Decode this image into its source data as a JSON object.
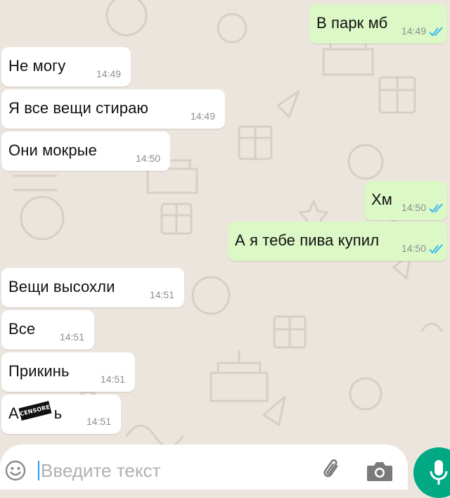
{
  "messages": [
    {
      "dir": "out",
      "text": "В парк мб",
      "time": "14:49",
      "read": true
    },
    {
      "dir": "in",
      "text": "Не могу",
      "time": "14:49"
    },
    {
      "dir": "in",
      "text": "Я все вещи стираю",
      "time": "14:49"
    },
    {
      "dir": "in",
      "text": "Они мокрые",
      "time": "14:50"
    },
    {
      "dir": "out",
      "text": "Хм",
      "time": "14:50",
      "read": true
    },
    {
      "dir": "out",
      "text": "А я тебе пива купил",
      "time": "14:50",
      "read": true
    },
    {
      "dir": "in",
      "text": "Вещи высохли",
      "time": "14:51"
    },
    {
      "dir": "in",
      "text": "Все",
      "time": "14:51"
    },
    {
      "dir": "in",
      "text": "Прикинь",
      "time": "14:51"
    },
    {
      "dir": "in",
      "text_prefix": "А",
      "censored_label": "CENSORED",
      "text_suffix": "ь",
      "time": "14:51"
    }
  ],
  "input": {
    "placeholder": "Введите текст"
  },
  "icons": {
    "emoji": "emoji-icon",
    "attach": "paperclip-icon",
    "camera": "camera-icon",
    "mic": "microphone-icon",
    "read_receipt": "double-check-icon"
  },
  "colors": {
    "background": "#ece5dd",
    "incoming_bubble": "#ffffff",
    "outgoing_bubble": "#dcf8c6",
    "read_ticks": "#34b7f1",
    "mic_button": "#00a884"
  }
}
